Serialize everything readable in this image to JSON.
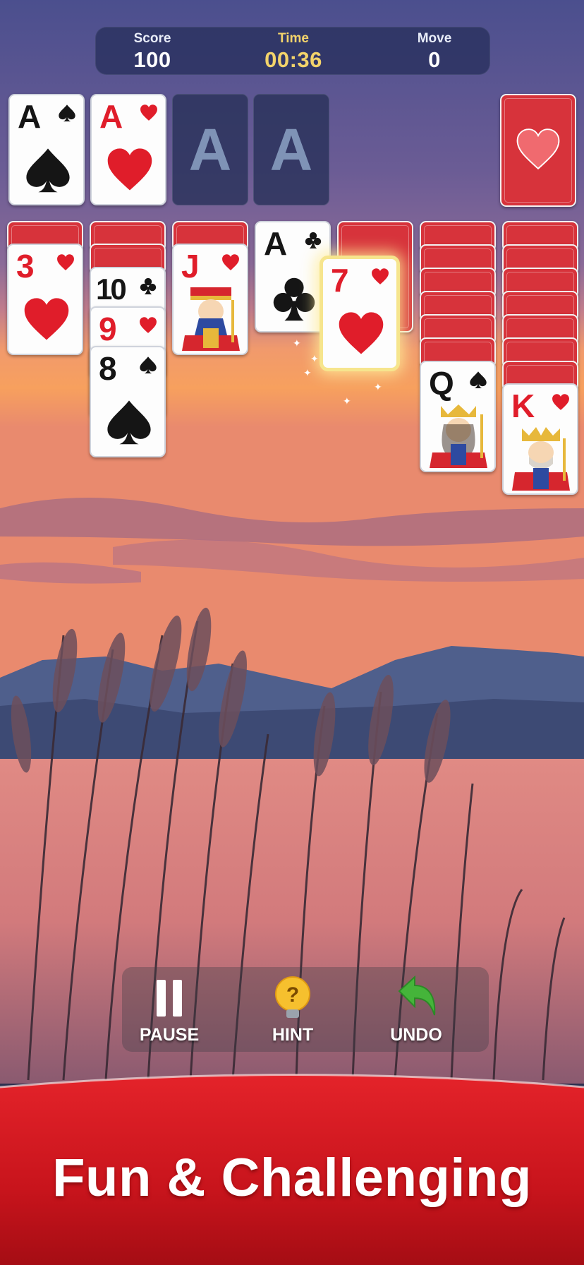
{
  "hud": {
    "score_label": "Score",
    "score_value": "100",
    "time_label": "Time",
    "time_value": "00:36",
    "move_label": "Move",
    "move_value": "0"
  },
  "foundations": [
    {
      "rank": "A",
      "suit": "spade",
      "color": "black"
    },
    {
      "rank": "A",
      "suit": "heart",
      "color": "red"
    },
    {
      "placeholder": "A"
    },
    {
      "placeholder": "A"
    }
  ],
  "stock": {
    "state": "face-down",
    "emblem": "heart"
  },
  "tableau": [
    {
      "hidden": 1,
      "cards": [
        {
          "rank": "3",
          "suit": "heart",
          "color": "red"
        }
      ]
    },
    {
      "hidden": 2,
      "cards": [
        {
          "rank": "10",
          "suit": "club",
          "color": "black"
        },
        {
          "rank": "9",
          "suit": "heart",
          "color": "red"
        },
        {
          "rank": "8",
          "suit": "spade",
          "color": "black"
        }
      ]
    },
    {
      "hidden": 1,
      "cards": [
        {
          "rank": "J",
          "suit": "heart",
          "color": "red",
          "face": "jack"
        }
      ]
    },
    {
      "hidden": 0,
      "cards": [
        {
          "rank": "A",
          "suit": "club",
          "color": "black"
        }
      ]
    },
    {
      "hidden": 1,
      "cards": [
        {
          "rank": "7",
          "suit": "heart",
          "color": "red",
          "highlighted": true,
          "state": "dragging"
        }
      ]
    },
    {
      "hidden": 6,
      "cards": [
        {
          "rank": "Q",
          "suit": "spade",
          "color": "black",
          "face": "queen"
        }
      ]
    },
    {
      "hidden": 7,
      "cards": [
        {
          "rank": "K",
          "suit": "heart",
          "color": "red",
          "face": "king"
        }
      ]
    }
  ],
  "toolbar": {
    "pause_label": "PAUSE",
    "pause_icon": "pause-icon",
    "hint_label": "HINT",
    "hint_icon": "lightbulb-icon",
    "undo_label": "UNDO",
    "undo_icon": "undo-arrow-icon"
  },
  "banner": {
    "text": "Fun & Challenging"
  },
  "colors": {
    "red_suit": "#e01d2a",
    "black_suit": "#151515",
    "card_back": "#d7333b",
    "time_accent": "#f3d36b",
    "banner_red": "#c8141c"
  }
}
